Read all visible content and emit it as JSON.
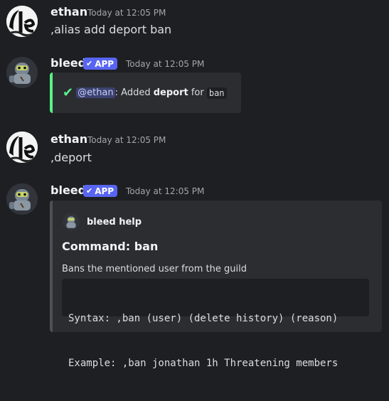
{
  "messages": [
    {
      "author": "ethan",
      "time": "Today at 12:05 PM",
      "text": ",alias add deport ban"
    },
    {
      "author": "bleed",
      "badge": "APP",
      "time": "Today at 12:05 PM",
      "embed": {
        "mention": "@ethan",
        "prefix_text": ": Added ",
        "bold": "deport",
        "mid_text": " for ",
        "code": "ban",
        "bar_color": "#57f287"
      }
    },
    {
      "author": "ethan",
      "time": "Today at 12:05 PM",
      "text": ",deport"
    },
    {
      "author": "bleed",
      "badge": "APP",
      "time": "Today at 12:05 PM",
      "embed": {
        "author_name": "bleed help",
        "title": "Command: ban",
        "description": "Bans the mentioned user from the guild",
        "code_lines": [
          "Syntax: ,ban (user) (delete history) (reason)",
          "Example: ,ban jonathan 1h Threatening members"
        ],
        "bar_color": "#4e5058"
      }
    }
  ],
  "colors": {
    "check": "#57f287",
    "badge": "#5865f2"
  }
}
